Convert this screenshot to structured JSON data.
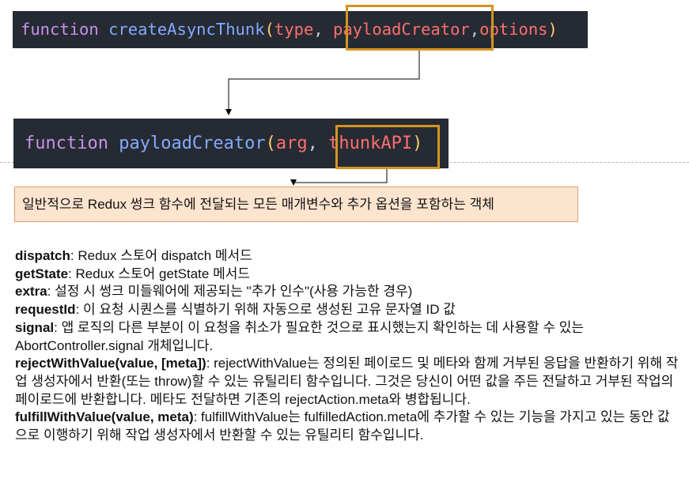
{
  "code1": {
    "keyword": "function",
    "name": "createAsyncThunk",
    "open": "(",
    "param1": "type",
    "comma1": ", ",
    "param2": "payloadCreator",
    "comma2": ",",
    "param3": "options",
    "close": ")"
  },
  "code2": {
    "keyword": "function",
    "name": "payloadCreator",
    "open": "(",
    "param1": "arg",
    "comma1": ", ",
    "param2": "thunkAPI",
    "close": ")"
  },
  "note": "일반적으로 Redux 썽크 함수에 전달되는 모든 매개변수와 추가 옵션을 포함하는 객체",
  "items": [
    {
      "term": "dispatch",
      "desc": ": Redux 스토어 dispatch 메서드"
    },
    {
      "term": "getState",
      "desc": ": Redux 스토어 getState 메서드"
    },
    {
      "term": "extra",
      "desc": ": 설정 시 썽크 미들웨어에 제공되는 \"추가 인수\"(사용 가능한 경우)"
    },
    {
      "term": "requestId",
      "desc": ": 이 요청 시퀀스를 식별하기 위해 자동으로 생성된 고유 문자열 ID 값"
    },
    {
      "term": "signal",
      "desc": ": 앱 로직의 다른 부분이 이 요청을 취소가 필요한 것으로 표시했는지 확인하는 데 사용할 수 있는 AbortController.signal 개체입니다."
    },
    {
      "term": "rejectWithValue(value, [meta])",
      "desc": ": rejectWithValue는 정의된 페이로드 및 메타와 함께 거부된 응답을 반환하기 위해 작업 생성자에서 반환(또는 throw)할 수 있는 유틸리티 함수입니다. 그것은 당신이 어떤 값을 주든 전달하고 거부된 작업의 페이로드에 반환합니다. 메타도 전달하면 기존의 rejectAction.meta와 병합됩니다."
    },
    {
      "term": "fulfillWithValue(value, meta)",
      "desc": ": fulfillWithValue는 fulfilledAction.meta에 추가할 수 있는 기능을 가지고 있는 동안 값으로 이행하기 위해 작업 생성자에서 반환할 수 있는 유틸리티 함수입니다."
    }
  ],
  "colors": {
    "code_bg": "#262b33",
    "keyword": "#c792ea",
    "function_name": "#82aaff",
    "paren": "#ffcb6b",
    "argument": "#ff6e6e",
    "highlight_border": "#d3951f",
    "note_bg": "#fde4cf",
    "note_border": "#e0a070"
  }
}
